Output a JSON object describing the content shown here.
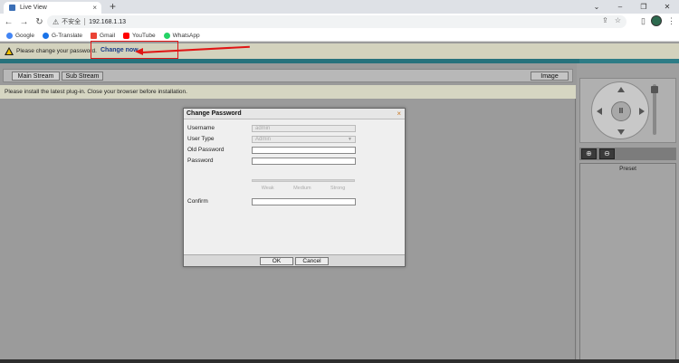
{
  "browser": {
    "tab_title": "Live View",
    "tab_close": "×",
    "new_tab": "+",
    "window_controls": [
      "⌄",
      "–",
      "❐",
      "✕"
    ],
    "insecure_label": "不安全",
    "url": "192.168.1.13",
    "bookmarks": [
      {
        "label": "Google",
        "color": "#4285f4"
      },
      {
        "label": "G-Translate",
        "color": "#1a73e8"
      },
      {
        "label": "Gmail",
        "color": "#ea4335"
      },
      {
        "label": "YouTube",
        "color": "#ff0000"
      },
      {
        "label": "WhatsApp",
        "color": "#25d366"
      }
    ]
  },
  "password_bar": {
    "message": "Please change your password.",
    "link": "Change now",
    "annotation_color": "#e01515"
  },
  "live_view": {
    "main_stream": "Main Stream",
    "sub_stream": "Sub Stream",
    "image": "Image",
    "plugin_notice": "Please install the latest plug-in. Close your browser before installation.",
    "preset": "Preset",
    "zoom_in": "⊕",
    "zoom_out": "⊖",
    "ptz_pause": "II"
  },
  "dialog": {
    "title": "Change Password",
    "close": "×",
    "username_label": "Username",
    "username_value": "admin",
    "user_type_label": "User Type",
    "user_type_value": "Admin",
    "old_password_label": "Old Password",
    "password_label": "Password",
    "strength": [
      "Weak",
      "Medium",
      "Strong"
    ],
    "confirm_label": "Confirm",
    "ok": "OK",
    "cancel": "Cancel"
  },
  "colors": {
    "teal_band": "#2e7c86",
    "notice_bar": "#d3d2bd"
  }
}
